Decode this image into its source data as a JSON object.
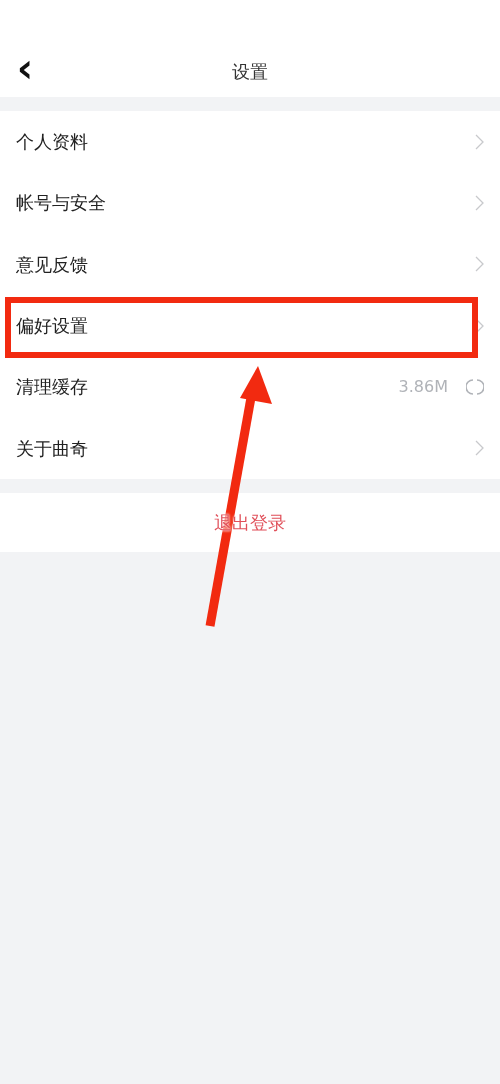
{
  "header": {
    "back": "‹",
    "title": "设置"
  },
  "items": [
    {
      "kind": "link",
      "label": "个人资料",
      "highlighted": false
    },
    {
      "kind": "link",
      "label": "帐号与安全",
      "highlighted": false
    },
    {
      "kind": "link",
      "label": "意见反馈",
      "highlighted": false
    },
    {
      "kind": "link",
      "label": "偏好设置",
      "highlighted": true
    },
    {
      "kind": "cache",
      "label": "清理缓存",
      "value": "3.86M",
      "highlighted": false
    },
    {
      "kind": "link",
      "label": "关于曲奇",
      "highlighted": false
    }
  ],
  "logout": "退出登录"
}
